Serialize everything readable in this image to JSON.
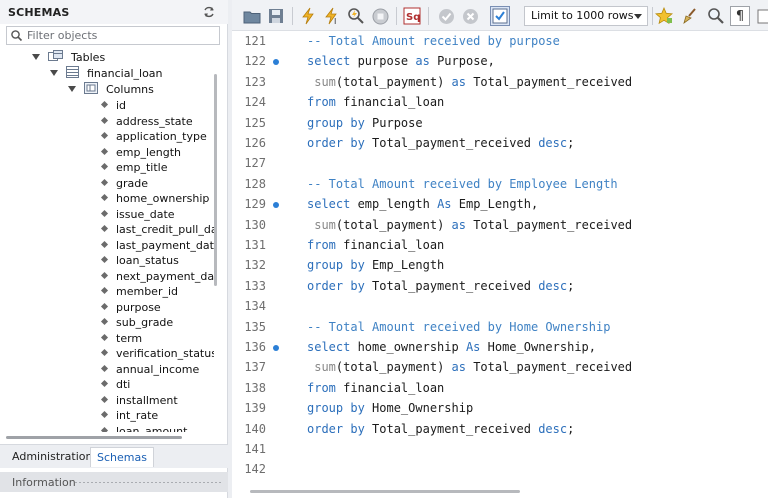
{
  "sidebar": {
    "title": "SCHEMAS",
    "filter_placeholder": "Filter objects",
    "tables_label": "Tables",
    "table_name": "financial_loan",
    "columns_label": "Columns",
    "columns": [
      "id",
      "address_state",
      "application_type",
      "emp_length",
      "emp_title",
      "grade",
      "home_ownership",
      "issue_date",
      "last_credit_pull_da",
      "last_payment_date",
      "loan_status",
      "next_payment_dat",
      "member_id",
      "purpose",
      "sub_grade",
      "term",
      "verification_status",
      "annual_income",
      "dti",
      "installment",
      "int_rate",
      "loan_amount"
    ],
    "tabs": {
      "administration": "Administration",
      "schemas": "Schemas"
    },
    "info_label": "Information"
  },
  "toolbar": {
    "limit_value": "Limit to 1000 rows",
    "icons": [
      "open-folder-icon",
      "save-icon",
      "execute-icon",
      "execute-current-icon",
      "explain-icon",
      "stop-icon",
      "toggle-results-icon",
      "commit-icon",
      "rollback-icon",
      "autocommit-icon",
      "favorite-icon",
      "beautify-icon",
      "find-icon",
      "invisible-chars-icon",
      "wrap-icon"
    ]
  },
  "colors": {
    "keyword": "#2c6fbb",
    "comment": "#3f82c4",
    "function": "#888888",
    "breakpoint": "#2b7fd6"
  },
  "editor": {
    "lines": [
      {
        "num": "121",
        "dot": false,
        "tokens": [
          {
            "t": "-- Total Amount received by purpose",
            "c": "cm"
          }
        ]
      },
      {
        "num": "122",
        "dot": true,
        "tokens": [
          {
            "t": "select",
            "c": "kw"
          },
          {
            "t": " purpose "
          },
          {
            "t": "as",
            "c": "kw"
          },
          {
            "t": " Purpose,"
          }
        ]
      },
      {
        "num": "123",
        "dot": false,
        "tokens": [
          {
            "t": " "
          },
          {
            "t": "sum",
            "c": "fn"
          },
          {
            "t": "(total_payment) "
          },
          {
            "t": "as",
            "c": "kw"
          },
          {
            "t": " Total_payment_received"
          }
        ]
      },
      {
        "num": "124",
        "dot": false,
        "tokens": [
          {
            "t": "from",
            "c": "kw"
          },
          {
            "t": " financial_loan"
          }
        ]
      },
      {
        "num": "125",
        "dot": false,
        "tokens": [
          {
            "t": "group by",
            "c": "kw"
          },
          {
            "t": " Purpose"
          }
        ]
      },
      {
        "num": "126",
        "dot": false,
        "tokens": [
          {
            "t": "order by",
            "c": "kw"
          },
          {
            "t": " Total_payment_received "
          },
          {
            "t": "desc",
            "c": "kw"
          },
          {
            "t": ";"
          }
        ]
      },
      {
        "num": "127",
        "dot": false,
        "tokens": []
      },
      {
        "num": "128",
        "dot": false,
        "tokens": [
          {
            "t": "-- Total Amount received by Employee Length",
            "c": "cm"
          }
        ]
      },
      {
        "num": "129",
        "dot": true,
        "tokens": [
          {
            "t": "select",
            "c": "kw"
          },
          {
            "t": " emp_length "
          },
          {
            "t": "As",
            "c": "kw"
          },
          {
            "t": " Emp_Length,"
          }
        ]
      },
      {
        "num": "130",
        "dot": false,
        "tokens": [
          {
            "t": " "
          },
          {
            "t": "sum",
            "c": "fn"
          },
          {
            "t": "(total_payment) "
          },
          {
            "t": "as",
            "c": "kw"
          },
          {
            "t": " Total_payment_received"
          }
        ]
      },
      {
        "num": "131",
        "dot": false,
        "tokens": [
          {
            "t": "from",
            "c": "kw"
          },
          {
            "t": " financial_loan"
          }
        ]
      },
      {
        "num": "132",
        "dot": false,
        "tokens": [
          {
            "t": "group by",
            "c": "kw"
          },
          {
            "t": " Emp_Length"
          }
        ]
      },
      {
        "num": "133",
        "dot": false,
        "tokens": [
          {
            "t": "order by",
            "c": "kw"
          },
          {
            "t": " Total_payment_received "
          },
          {
            "t": "desc",
            "c": "kw"
          },
          {
            "t": ";"
          }
        ]
      },
      {
        "num": "134",
        "dot": false,
        "tokens": []
      },
      {
        "num": "135",
        "dot": false,
        "tokens": [
          {
            "t": "-- Total Amount received by Home Ownership",
            "c": "cm"
          }
        ]
      },
      {
        "num": "136",
        "dot": true,
        "tokens": [
          {
            "t": "select",
            "c": "kw"
          },
          {
            "t": " home_ownership "
          },
          {
            "t": "As",
            "c": "kw"
          },
          {
            "t": " Home_Ownership,"
          }
        ]
      },
      {
        "num": "137",
        "dot": false,
        "tokens": [
          {
            "t": " "
          },
          {
            "t": "sum",
            "c": "fn"
          },
          {
            "t": "(total_payment) "
          },
          {
            "t": "as",
            "c": "kw"
          },
          {
            "t": " Total_payment_received"
          }
        ]
      },
      {
        "num": "138",
        "dot": false,
        "tokens": [
          {
            "t": "from",
            "c": "kw"
          },
          {
            "t": " financial_loan"
          }
        ]
      },
      {
        "num": "139",
        "dot": false,
        "tokens": [
          {
            "t": "group by",
            "c": "kw"
          },
          {
            "t": " Home_Ownership"
          }
        ]
      },
      {
        "num": "140",
        "dot": false,
        "tokens": [
          {
            "t": "order by",
            "c": "kw"
          },
          {
            "t": " Total_payment_received "
          },
          {
            "t": "desc",
            "c": "kw"
          },
          {
            "t": ";"
          }
        ]
      },
      {
        "num": "141",
        "dot": false,
        "tokens": []
      },
      {
        "num": "142",
        "dot": false,
        "tokens": []
      }
    ]
  }
}
